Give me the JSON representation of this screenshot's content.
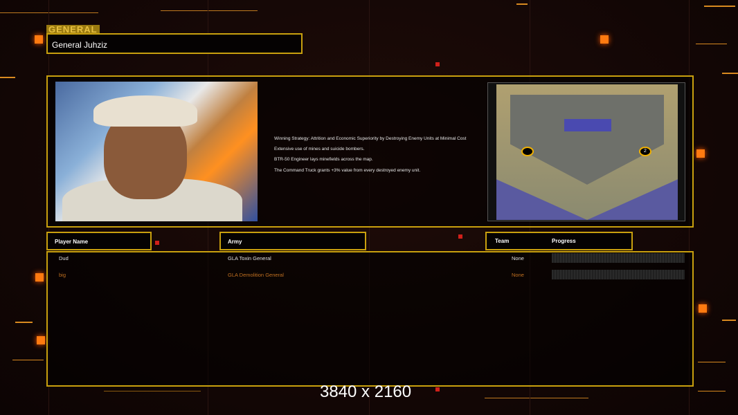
{
  "general_section": {
    "tab_label": "GENERAL",
    "general_name": "General Juhziz"
  },
  "strategy": {
    "lines": [
      "Winning Strategy: Attrition and Economic Superiority by Destroying Enemy Units at Minimal Cost",
      "Extensive use of mines and suicide bombers.",
      "BTR-50 Engineer lays minefields across the map.",
      "The Command Truck grants +3% value from every destroyed enemy unit."
    ]
  },
  "map": {
    "start_positions": [
      "",
      "2"
    ]
  },
  "table": {
    "headers": {
      "player": "Player Name",
      "army": "Army",
      "team": "Team",
      "progress": "Progress"
    },
    "rows": [
      {
        "player": "Dud",
        "army": "GLA Toxin General",
        "team": "None",
        "progress": 0,
        "color": "#e0e0e0"
      },
      {
        "player": "big",
        "army": "GLA Demolition General",
        "team": "None",
        "progress": 0,
        "color": "#c07020"
      }
    ]
  },
  "resolution_label": "3840 x 2160"
}
